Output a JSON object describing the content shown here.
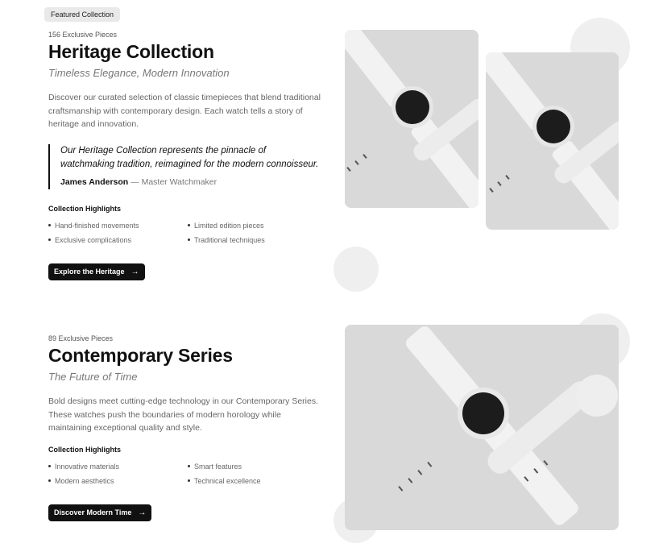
{
  "badge": "Featured Collection",
  "heritage": {
    "count": "156 Exclusive Pieces",
    "title": "Heritage Collection",
    "subtitle": "Timeless Elegance, Modern Innovation",
    "description": "Discover our curated selection of classic timepieces that blend traditional craftsmanship with contemporary design. Each watch tells a story of heritage and innovation.",
    "quote": "Our Heritage Collection represents the pinnacle of watchmaking tradition, reimagined for the modern connoisseur.",
    "quote_author": "James Anderson",
    "quote_role": "— Master Watchmaker",
    "highlights_title": "Collection Highlights",
    "highlights": [
      "Hand-finished movements",
      "Limited edition pieces",
      "Exclusive complications",
      "Traditional techniques"
    ],
    "button": "Explore the Heritage"
  },
  "contemporary": {
    "count": "89 Exclusive Pieces",
    "title": "Contemporary Series",
    "subtitle": "The Future of Time",
    "description": "Bold designs meet cutting-edge technology in our Contemporary Series. These watches push the boundaries of modern horology while maintaining exceptional quality and style.",
    "highlights_title": "Collection Highlights",
    "highlights": [
      "Innovative materials",
      "Smart features",
      "Modern aesthetics",
      "Technical excellence"
    ],
    "button": "Discover Modern Time"
  },
  "icons": {
    "button_arrow": "arrow-right-icon"
  },
  "colors": {
    "accent": "#111111",
    "muted_text": "#666666",
    "card_bg": "#d8d8d8",
    "circle_bg": "#efefef"
  }
}
